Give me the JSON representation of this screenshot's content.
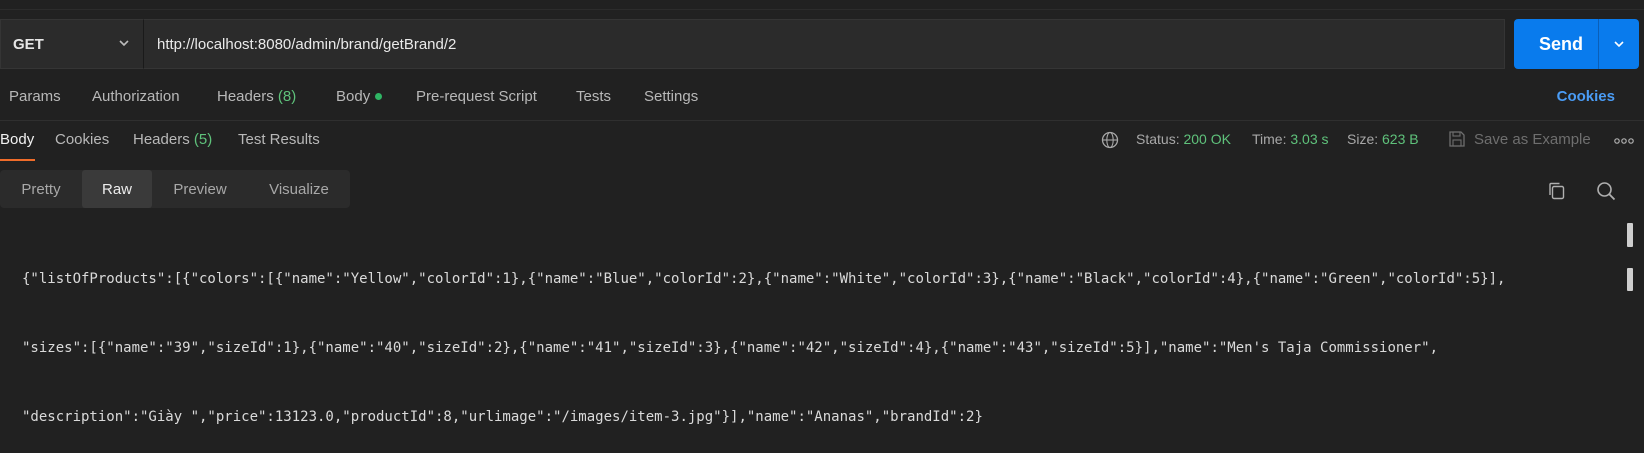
{
  "request": {
    "method": "GET",
    "url": "http://localhost:8080/admin/brand/getBrand/2",
    "send_label": "Send"
  },
  "request_tabs": {
    "params": "Params",
    "authorization": "Authorization",
    "headers": "Headers",
    "headers_count": "(8)",
    "body": "Body",
    "pre_request_script": "Pre-request Script",
    "tests": "Tests",
    "settings": "Settings",
    "cookies": "Cookies"
  },
  "response_tabs": {
    "body": "Body",
    "cookies": "Cookies",
    "headers": "Headers",
    "headers_count": "(5)",
    "test_results": "Test Results"
  },
  "response_meta": {
    "status_label": "Status:",
    "status_value": "200 OK",
    "time_label": "Time:",
    "time_value": "3.03 s",
    "size_label": "Size:",
    "size_value": "623 B",
    "save_as_example": "Save as Example"
  },
  "view_tabs": {
    "pretty": "Pretty",
    "raw": "Raw",
    "preview": "Preview",
    "visualize": "Visualize"
  },
  "response_body_lines": [
    "{\"listOfProducts\":[{\"colors\":[{\"name\":\"Yellow\",\"colorId\":1},{\"name\":\"Blue\",\"colorId\":2},{\"name\":\"White\",\"colorId\":3},{\"name\":\"Black\",\"colorId\":4},{\"name\":\"Green\",\"colorId\":5}],",
    "\"sizes\":[{\"name\":\"39\",\"sizeId\":1},{\"name\":\"40\",\"sizeId\":2},{\"name\":\"41\",\"sizeId\":3},{\"name\":\"42\",\"sizeId\":4},{\"name\":\"43\",\"sizeId\":5}],\"name\":\"Men's Taja Commissioner\",",
    "\"description\":\"Giày \",\"price\":13123.0,\"productId\":8,\"urlimage\":\"/images/item-3.jpg\"}],\"name\":\"Ananas\",\"brandId\":2}"
  ],
  "colors": {
    "background": "#212121",
    "send_button": "#097bed",
    "status_green": "#5fc27b",
    "accent_orange": "#ef6c2a",
    "cookies_link": "#4a9cf5"
  }
}
